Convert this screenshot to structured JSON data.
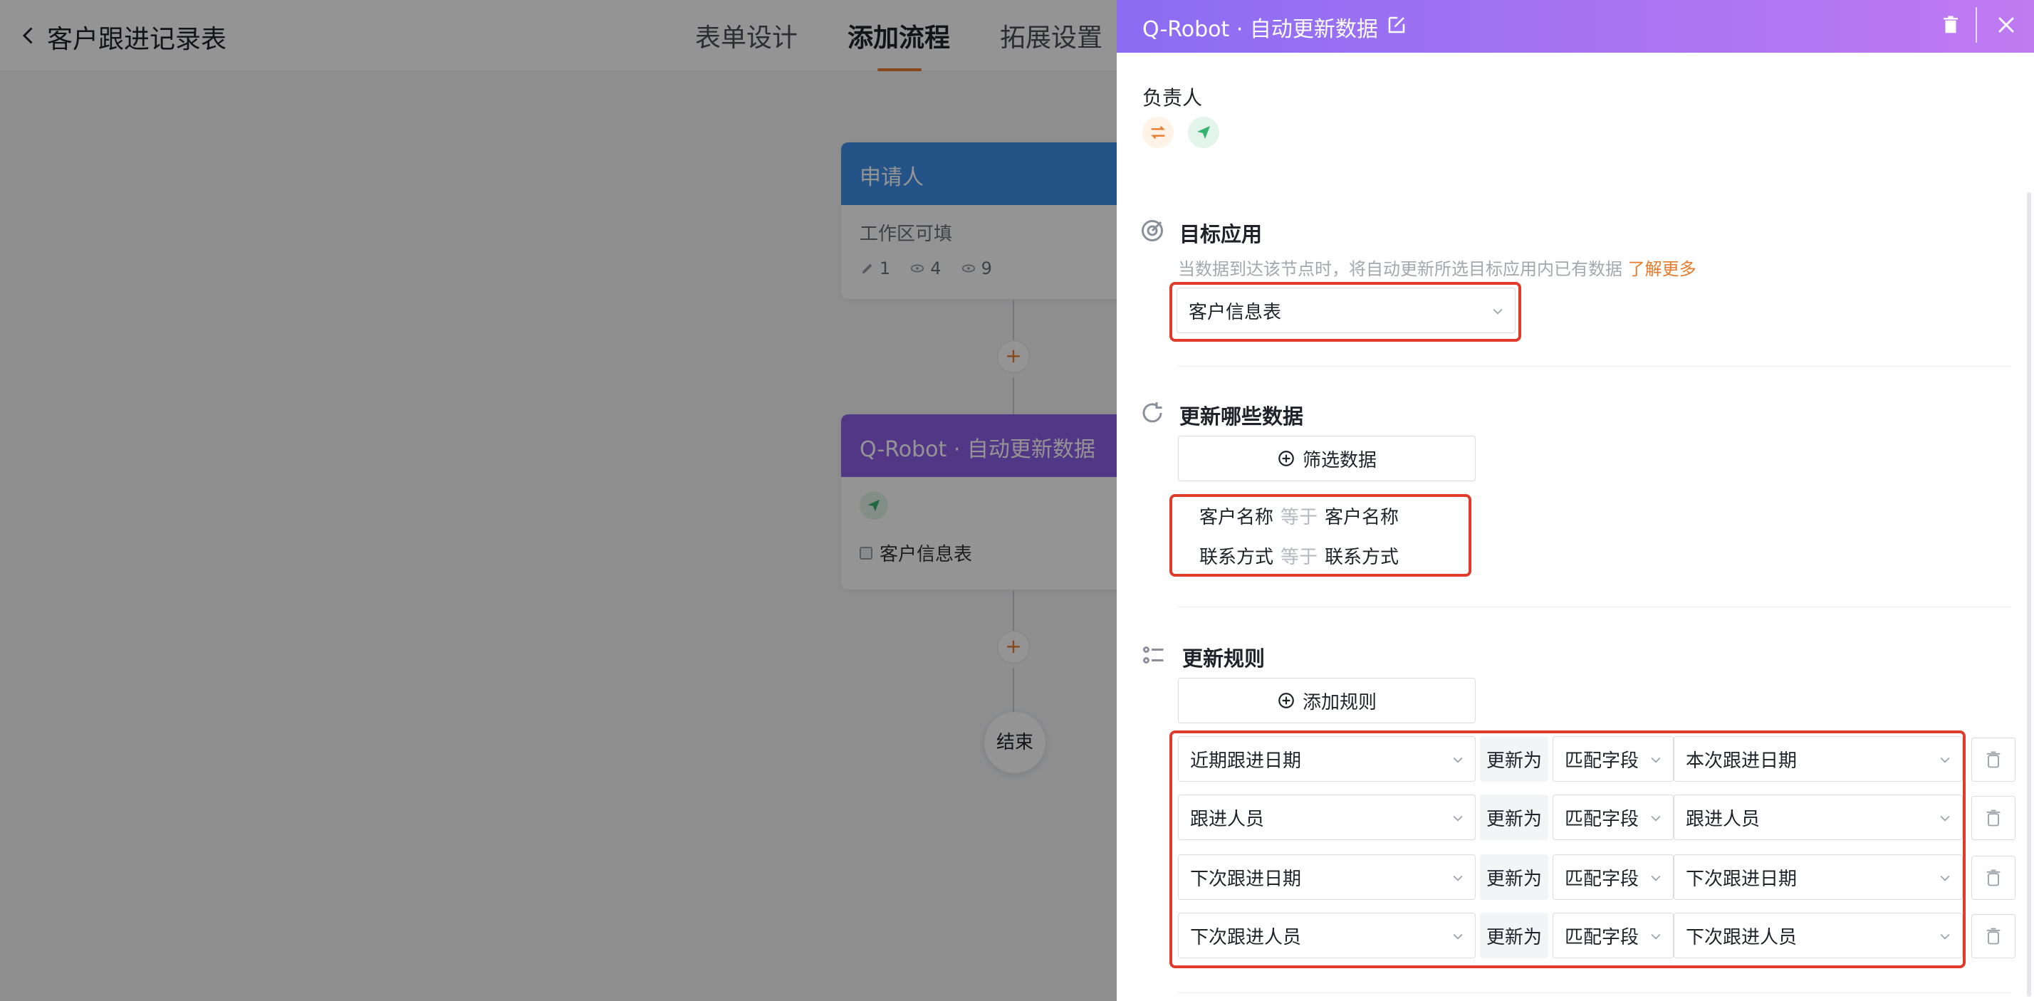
{
  "header": {
    "page_title": "客户跟进记录表",
    "tabs": [
      {
        "label": "表单设计",
        "active": false
      },
      {
        "label": "添加流程",
        "active": true
      },
      {
        "label": "拓展设置",
        "active": false
      }
    ]
  },
  "flow": {
    "applicant_node": {
      "title": "申请人",
      "desc": "工作区可填",
      "edit_count": "1",
      "view_count": "4",
      "hidden_count": "9"
    },
    "robot_node": {
      "title": "Q-Robot · 自动更新数据",
      "target_form": "客户信息表"
    },
    "add_symbol": "+",
    "end_label": "结束"
  },
  "drawer": {
    "title": "Q-Robot · 自动更新数据",
    "owner_label": "负责人",
    "target_app": {
      "title": "目标应用",
      "hint": "当数据到达该节点时，将自动更新所选目标应用内已有数据",
      "learn_more": "了解更多",
      "selected": "客户信息表"
    },
    "update_data": {
      "title": "更新哪些数据",
      "filter_button": "筛选数据",
      "conditions": [
        {
          "field": "客户名称",
          "op": "等于",
          "value": "客户名称"
        },
        {
          "field": "联系方式",
          "op": "等于",
          "value": "联系方式"
        }
      ]
    },
    "update_rules": {
      "title": "更新规则",
      "add_button": "添加规则",
      "update_to_label": "更新为",
      "rules": [
        {
          "target": "近期跟进日期",
          "mode": "匹配字段",
          "source": "本次跟进日期"
        },
        {
          "target": "跟进人员",
          "mode": "匹配字段",
          "source": "跟进人员"
        },
        {
          "target": "下次跟进日期",
          "mode": "匹配字段",
          "source": "下次跟进日期"
        },
        {
          "target": "下次跟进人员",
          "mode": "匹配字段",
          "source": "下次跟进人员"
        }
      ]
    }
  },
  "colors": {
    "accent": "#e87a2c",
    "drawer_gradient_start": "#8b6cf2",
    "drawer_gradient_end": "#c07af2",
    "highlight_box": "#e03a2b",
    "applicant_blue": "#3d8fe8",
    "robot_purple": "#8d5fe8"
  },
  "icons": {
    "back": "chevron-left-icon",
    "edit": "edit-icon",
    "delete": "trash-icon",
    "close": "close-icon",
    "owner_switch": "swap-arrows-icon",
    "owner_send": "paper-plane-icon",
    "target_app": "target-icon",
    "update_data": "refresh-icon",
    "update_rules": "list-icon",
    "add": "plus-circle-icon"
  }
}
